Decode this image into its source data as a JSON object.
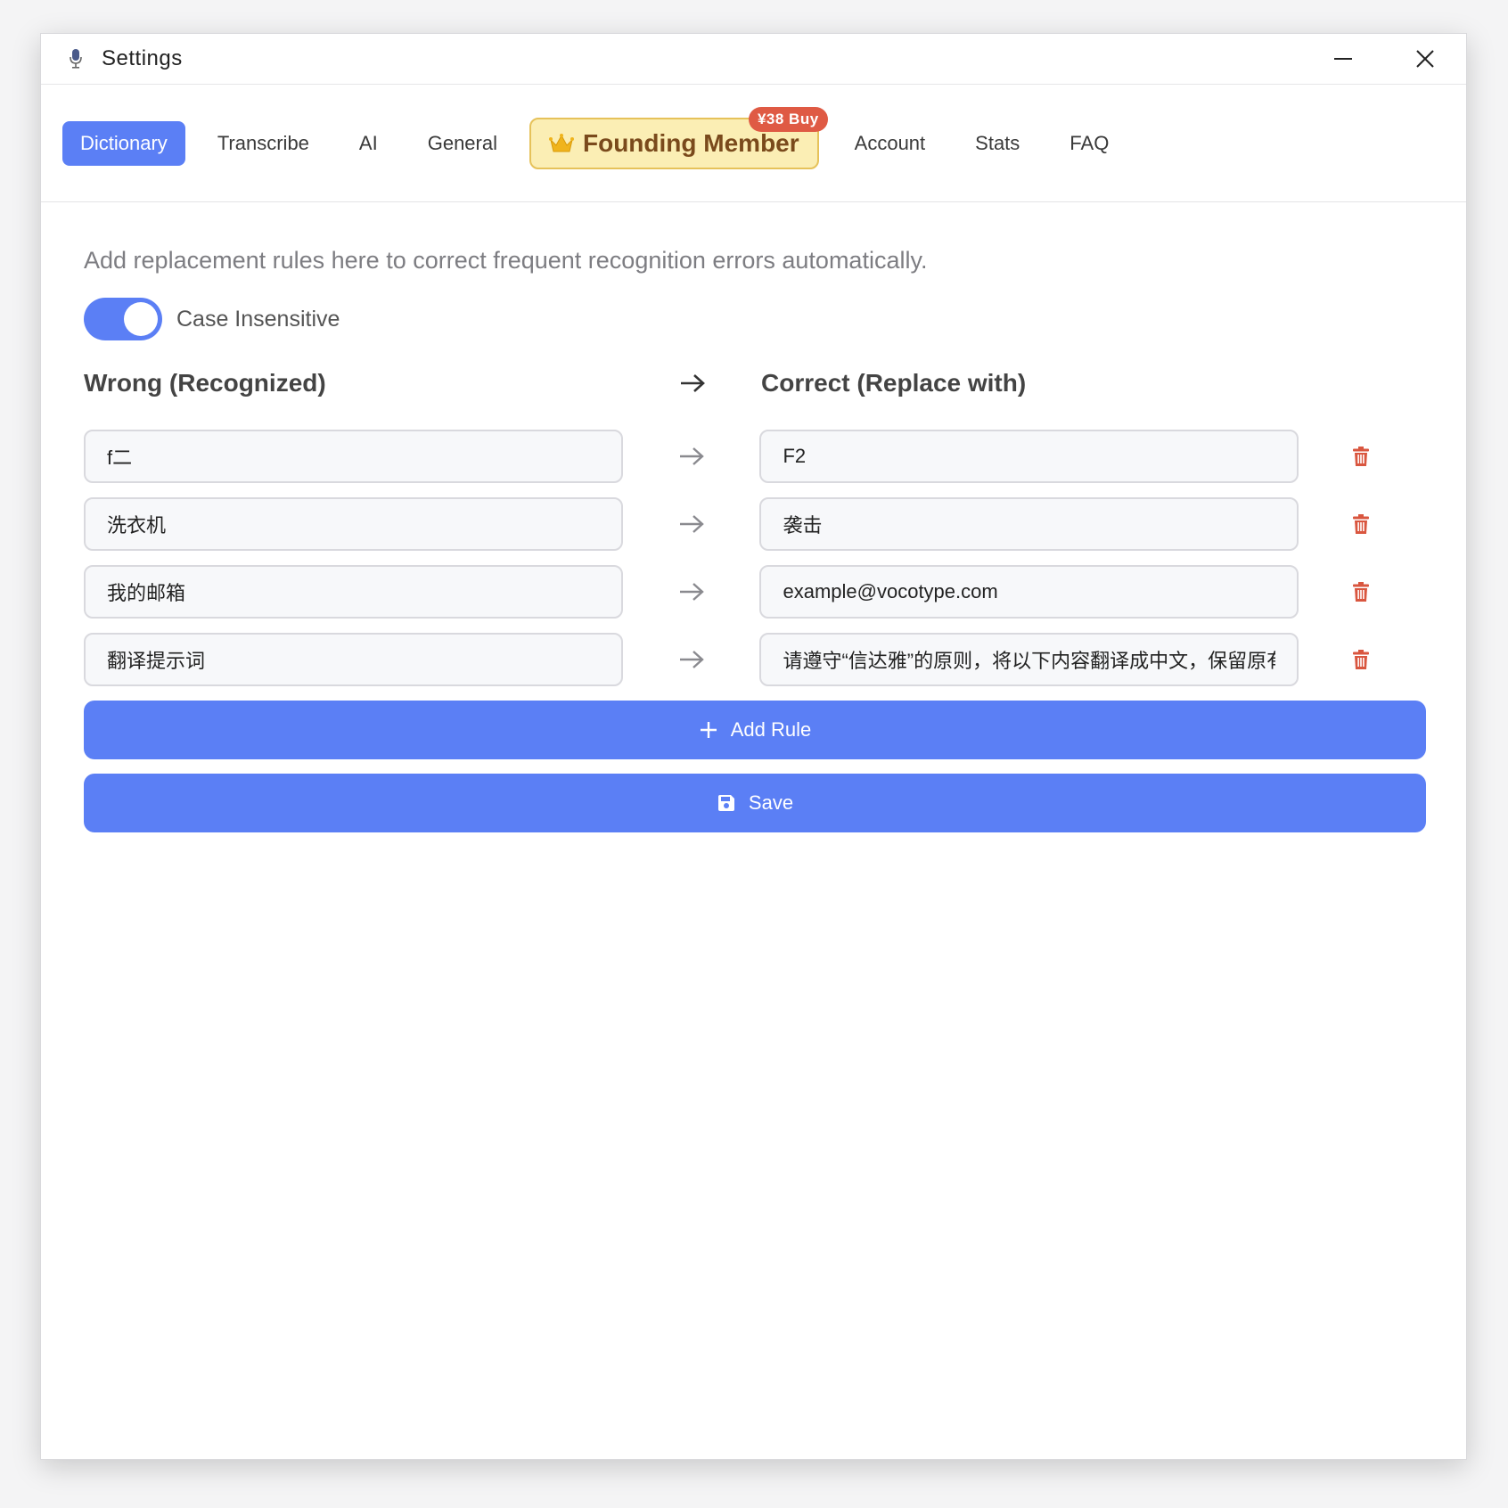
{
  "window": {
    "title": "Settings"
  },
  "tabs": {
    "items": [
      {
        "label": "Dictionary",
        "active": true
      },
      {
        "label": "Transcribe"
      },
      {
        "label": "AI"
      },
      {
        "label": "General"
      }
    ],
    "founding": {
      "label": "Founding Member",
      "badge": "¥38 Buy",
      "icon": "crown-icon"
    },
    "items_after": [
      {
        "label": "Account"
      },
      {
        "label": "Stats"
      },
      {
        "label": "FAQ"
      }
    ]
  },
  "dictionary": {
    "description": "Add replacement rules here to correct frequent recognition errors automatically.",
    "case_insensitive": {
      "label": "Case Insensitive",
      "enabled": true
    },
    "header_wrong": "Wrong (Recognized)",
    "header_correct": "Correct (Replace with)",
    "rules": [
      {
        "wrong": "f二",
        "correct": "F2"
      },
      {
        "wrong": "洗衣机",
        "correct": "袭击"
      },
      {
        "wrong": "我的邮箱",
        "correct": "example@vocotype.com"
      },
      {
        "wrong": "翻译提示词",
        "correct": "请遵守“信达雅”的原则，将以下内容翻译成中文，保留原有"
      }
    ],
    "add_rule_label": "Add Rule",
    "save_label": "Save"
  },
  "colors": {
    "accent": "#5b7ff5",
    "delete": "#d9563f",
    "founding_bg": "#fbeeb4",
    "founding_text": "#7a4a1c",
    "badge": "#df5a44"
  }
}
